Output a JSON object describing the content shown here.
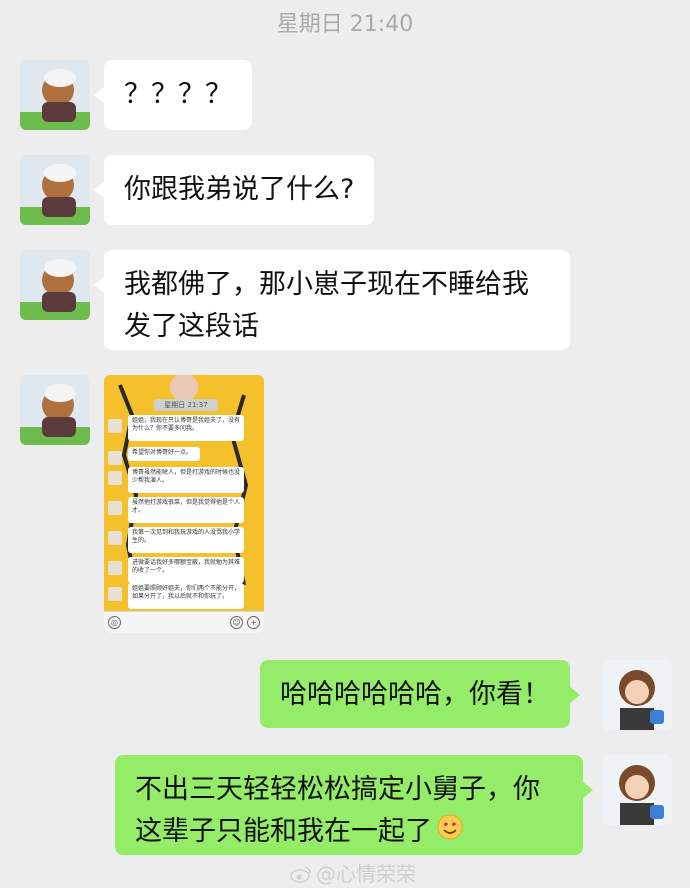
{
  "header": {
    "timestamp": "星期日 21:40"
  },
  "messages": [
    {
      "side": "left",
      "text": "？？？？"
    },
    {
      "side": "left",
      "text": "你跟我弟说了什么?"
    },
    {
      "side": "left",
      "text_line1": "我都佛了，那小崽子现在不睡给我",
      "text_line2": "发了这段话"
    },
    {
      "side": "left",
      "type": "image",
      "inner": {
        "status": "星期日 21:37",
        "rows": [
          "姐姐，我现在只认博哥是我姐夫了，没有为什么？你不要多问我。",
          "希望你对博哥好一点。",
          "博哥虽然能唬人，但是打游戏的时候也没少帮我演人。",
          "虽然他打游戏很菜，但是我觉得他是个人才。",
          "我第一次见到和我玩游戏的人没骂我小学生的。",
          "进微要话我好多哪额宝蔽，我就勉为其难的收了一个。",
          "姐姐要照顾好姐夫，你们两个不能分开，如果分开了，我以后就不和你玩了。"
        ]
      }
    },
    {
      "side": "right",
      "text": "哈哈哈哈哈哈，你看！"
    },
    {
      "side": "right",
      "text_line1": "不出三天轻轻松松搞定小舅子，你",
      "text_line2": "这辈子只能和我在一起了"
    }
  ],
  "watermark": "@心情荣荣",
  "colors": {
    "background": "#ededed",
    "bubble_left": "#ffffff",
    "bubble_right": "#95ec69",
    "image_bg": "#f4c02c"
  }
}
